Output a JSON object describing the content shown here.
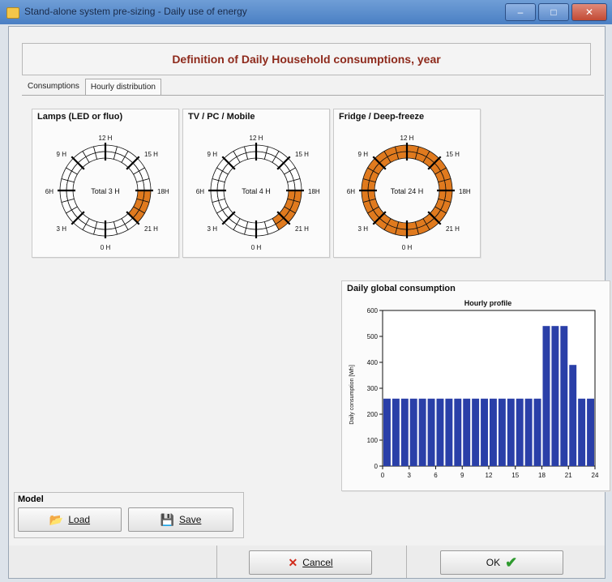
{
  "window": {
    "title": "Stand-alone system pre-sizing - Daily use of energy",
    "minimize_glyph": "–",
    "maximize_glyph": "□",
    "close_glyph": "✕"
  },
  "header": {
    "title": "Definition of Daily Household consumptions, year"
  },
  "tabs": [
    {
      "label": "Consumptions",
      "active": false
    },
    {
      "label": "Hourly distribution",
      "active": true
    }
  ],
  "clock_labels": {
    "h12": "12 H",
    "h15": "15 H",
    "h18": "18H",
    "h21": "21 H",
    "h0": "0 H",
    "h3": "3 H",
    "h6": "6H",
    "h9": "9 H"
  },
  "appliances": [
    {
      "title": "Lamps (LED or fluo)",
      "total_label": "Total 3 H",
      "hours_on": [
        18,
        19,
        20
      ]
    },
    {
      "title": "TV / PC / Mobile",
      "total_label": "Total 4 H",
      "hours_on": [
        18,
        19,
        20,
        21
      ]
    },
    {
      "title": "Fridge / Deep-freeze",
      "total_label": "Total 24 H",
      "hours_on": [
        0,
        1,
        2,
        3,
        4,
        5,
        6,
        7,
        8,
        9,
        10,
        11,
        12,
        13,
        14,
        15,
        16,
        17,
        18,
        19,
        20,
        21,
        22,
        23
      ]
    }
  ],
  "chart_panel": {
    "title": "Daily global consumption"
  },
  "chart_data": {
    "type": "bar",
    "title": "Hourly profile",
    "xlabel": "",
    "ylabel": "Daily consumption [Wh]",
    "x": [
      0,
      1,
      2,
      3,
      4,
      5,
      6,
      7,
      8,
      9,
      10,
      11,
      12,
      13,
      14,
      15,
      16,
      17,
      18,
      19,
      20,
      21,
      22,
      23
    ],
    "values": [
      260,
      260,
      260,
      260,
      260,
      260,
      260,
      260,
      260,
      260,
      260,
      260,
      260,
      260,
      260,
      260,
      260,
      260,
      540,
      540,
      540,
      390,
      260,
      260
    ],
    "ylim": [
      0,
      600
    ],
    "xlim": [
      0,
      24
    ],
    "yticks": [
      0,
      100,
      200,
      300,
      400,
      500,
      600
    ],
    "xticks": [
      0,
      3,
      6,
      9,
      12,
      15,
      18,
      21,
      24
    ],
    "grid": false,
    "bar_color": "#2a3fa8"
  },
  "model": {
    "label": "Model",
    "load_label": "Load",
    "save_label": "Save"
  },
  "footer": {
    "cancel_label": "Cancel",
    "ok_label": "OK"
  },
  "colors": {
    "accent_orange": "#e07a1e",
    "title_red": "#8e2a1c",
    "bar_blue": "#2a3fa8",
    "cancel_red": "#d02a1a",
    "ok_green": "#2e9a2e"
  }
}
